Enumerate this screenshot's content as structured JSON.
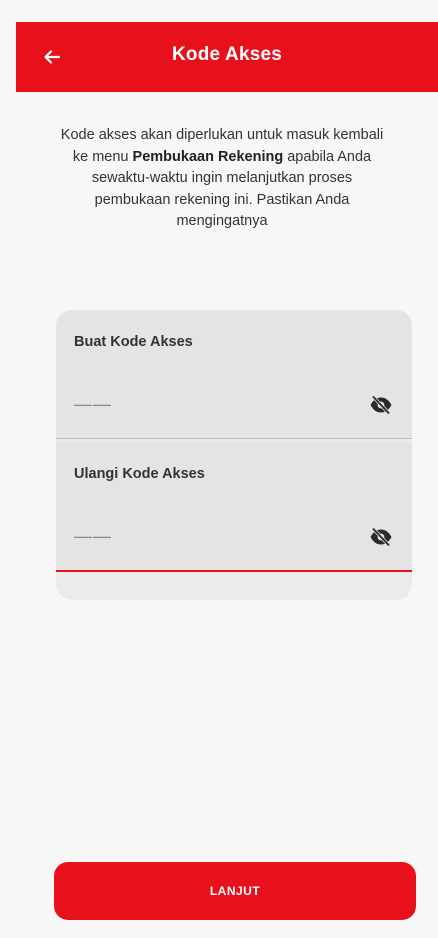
{
  "header": {
    "title": "Kode Akses",
    "back_icon": "arrow-left-icon",
    "background_color": "#e8111b"
  },
  "intro": {
    "part1": "Kode akses akan diperlukan untuk masuk kembali ke menu ",
    "bold": "Pembukaan Rekening",
    "part2": " apabila Anda sewaktu-waktu ingin melanjutkan proses pembukaan rekening ini. Pastikan Anda mengingatnya"
  },
  "form": {
    "fields": [
      {
        "label": "Buat Kode Akses",
        "value": "——",
        "icon": "eye-slash-icon"
      },
      {
        "label": "Ulangi Kode Akses",
        "value": "——",
        "icon": "eye-slash-icon"
      }
    ]
  },
  "actions": {
    "next_label": "LANJUT",
    "accent_color": "#e8111b"
  }
}
